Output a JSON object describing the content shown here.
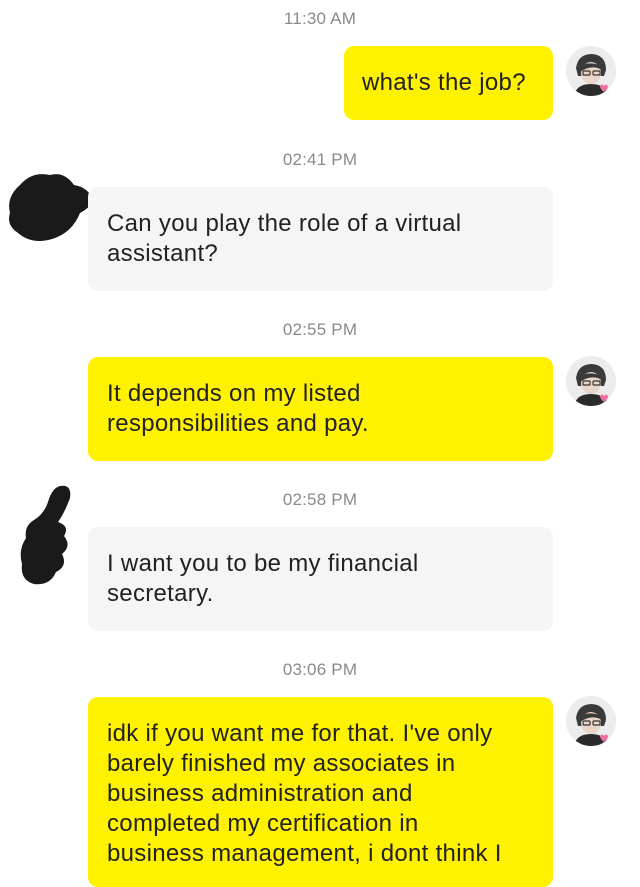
{
  "messages": [
    {
      "time": "11:30 AM",
      "sender": "me",
      "lines": [
        "what's the job?"
      ]
    },
    {
      "time": "02:41 PM",
      "sender": "other",
      "lines": [
        "Can you play the role of a virtual",
        "assistant?"
      ]
    },
    {
      "time": "02:55 PM",
      "sender": "me",
      "lines": [
        "It depends on my listed",
        "responsibilities and pay."
      ]
    },
    {
      "time": "02:58 PM",
      "sender": "other",
      "lines": [
        "I want you to be my financial",
        "secretary."
      ]
    },
    {
      "time": "03:06 PM",
      "sender": "me",
      "lines": [
        "idk if you want me for that. I've only",
        "barely finished my associates in",
        "business administration and",
        "completed my certification in",
        "business management, i dont think I"
      ]
    }
  ],
  "colors": {
    "outgoing_bubble": "#fff200",
    "incoming_bubble": "#f5f5f5",
    "timestamp_text": "#8a8a8a",
    "message_text": "#222222",
    "redaction": "#1a1a1a"
  },
  "icons": {
    "my_avatar": "user-avatar-icon",
    "other_avatar_redacted": "redacted-avatar-scribble"
  }
}
